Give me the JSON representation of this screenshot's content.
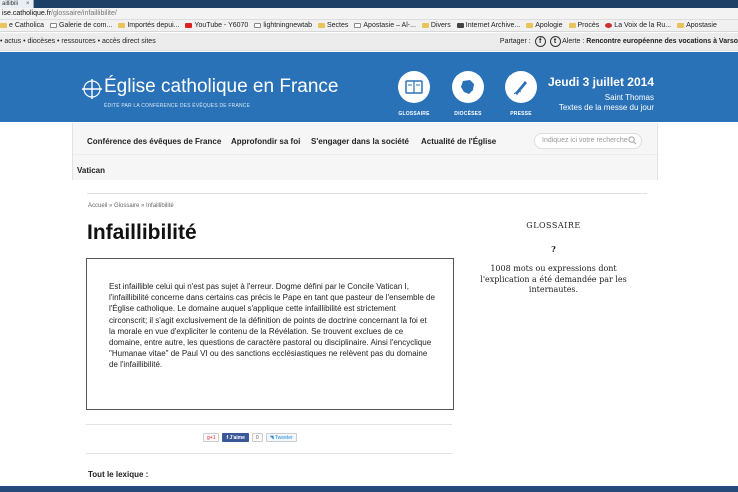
{
  "browser": {
    "tab_title": "aillibili",
    "tab_close": "×",
    "url_host": "ise.catholique.fr",
    "url_path": "/glossaire/infaillibilite/",
    "bookmarks": [
      {
        "label": "e Catholica",
        "icon": "folder-icon"
      },
      {
        "label": "Galerie de com...",
        "icon": "page-icon"
      },
      {
        "label": "Importés depui...",
        "icon": "folder-icon"
      },
      {
        "label": "YouTube - Y6070",
        "icon": "youtube-icon"
      },
      {
        "label": "lightningnewtab",
        "icon": "page-icon"
      },
      {
        "label": "Sectes",
        "icon": "folder-icon"
      },
      {
        "label": "Apostasie – Al-...",
        "icon": "page-icon"
      },
      {
        "label": "Divers",
        "icon": "folder-icon"
      },
      {
        "label": "Internet Archive...",
        "icon": "archive-icon"
      },
      {
        "label": "Apologie",
        "icon": "folder-icon"
      },
      {
        "label": "Procès",
        "icon": "folder-icon"
      },
      {
        "label": "La Voix de la Ru...",
        "icon": "voix-icon"
      },
      {
        "label": "Apostasie",
        "icon": "folder-icon"
      }
    ]
  },
  "topstrip": {
    "links": "• actus • diocèses • ressources • accès direct sites",
    "share_label": "Partager :",
    "alert_label": "Alerte :",
    "alert_text": "Rencontre européenne des vocations à Varso"
  },
  "header": {
    "title": "Église catholique en France",
    "subtitle": "ÉDITÉ PAR LA CONFÉRENCE DES ÉVÊQUES DE FRANCE",
    "buttons": [
      {
        "label": "GLOSSAIRE",
        "icon": "book-icon"
      },
      {
        "label": "DIOCÈSES",
        "icon": "map-icon"
      },
      {
        "label": "PRESSE",
        "icon": "pen-icon"
      }
    ],
    "date_line1": "Jeudi 3 juillet 2014",
    "date_line2": "Saint Thomas",
    "date_line3": "Textes de la messe du jour",
    "accent_color": "#2a72b7"
  },
  "nav": {
    "items": [
      "Conférence des évêques de France",
      "Approfondir sa foi",
      "S'engager dans la société",
      "Actualité de l'Église",
      "Vatican"
    ],
    "search_placeholder": "Indiquez ici votre recherche"
  },
  "main": {
    "breadcrumb": "Accueil » Glossaire » Infaillibilité",
    "title": "Infaillibilité",
    "definition": "Est infaillible celui qui n'est pas sujet à l'erreur. Dogme défini par le Concile Vatican I, l'infaillibilité concerne dans certains cas précis le Pape en tant que pasteur de l'ensemble de l'Église catholique. Le domaine auquel s'applique cette infaillibilité est strictement circonscrit; il s'agit exclusivement de la définition de points de doctrine concernant la foi et la morale en vue d'expliciter le contenu de la Révélation. Se trouvent exclues de ce domaine, entre autre, les questions de caractère pastoral ou disciplinaire. Ainsi l'encyclique \"Humanae vitae\" de Paul VI ou des sanctions ecclésiastiques ne relèvent pas du domaine de l'infaillibilité.",
    "share": {
      "gplus": "g+1",
      "like": "J'aime",
      "like_count": "0",
      "tweet": "Tweeter"
    },
    "lexique_label": "Tout le lexique :"
  },
  "sidebar": {
    "title": "GLOSSAIRE",
    "question": "?",
    "count_text": "1008 mots ou expressions dont l'explication a été demandée par les internautes."
  }
}
